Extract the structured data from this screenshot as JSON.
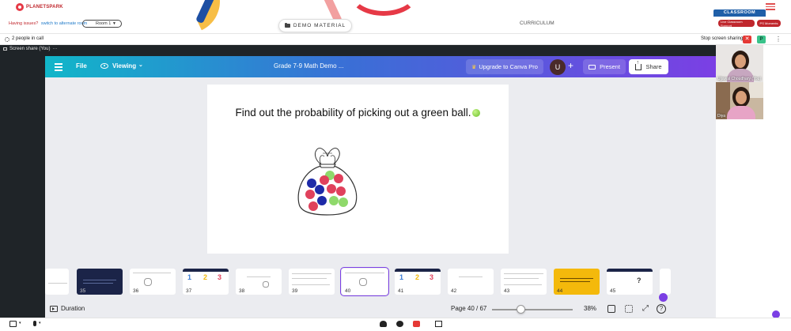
{
  "header": {
    "logo_text": "PLANETSPARK",
    "issues_text": "Having issues?",
    "alternate_room_link": "switch to alternate room",
    "room_select_value": "Room 1",
    "demo_material_label": "DEMO MATERIAL",
    "curriculum_label": "CURRICULUM",
    "classroom_tab": "CLASSROOM",
    "support_buttons": [
      "Live Classroom Support",
      "PS Moments"
    ]
  },
  "call": {
    "people_count_text": "2 people in call",
    "stop_sharing_label": "Stop screen sharing",
    "p_badge": "P",
    "screen_share_label": "Screen share (You)"
  },
  "canva": {
    "file_label": "File",
    "viewing_label": "Viewing",
    "doc_title": "Grade 7-9 Math Demo ...",
    "upgrade_label": "Upgrade to Canva Pro",
    "avatar_initial": "U",
    "present_label": "Present",
    "share_label": "Share",
    "slide_title": "Find out the probability of picking out a green ball.",
    "duration_label": "Duration",
    "page_label": "Page 40 / 67",
    "zoom_label": "38%",
    "zoom_fraction": 0.38,
    "current_page": 40,
    "thumbnails": [
      "35",
      "36",
      "37",
      "38",
      "39",
      "40",
      "41",
      "42",
      "43",
      "44",
      "45"
    ],
    "selected_thumbnail": "40",
    "help_label": "?"
  },
  "participants": [
    {
      "name": "Ujjawal Choudhary (You)"
    },
    {
      "name": "Diya"
    }
  ],
  "colors": {
    "canva_gradient_start": "#11b6c9",
    "canva_gradient_end": "#7b3fe4",
    "brand_red": "#c0272d",
    "ball_red": "#e0415c",
    "ball_blue": "#1d2aa8",
    "ball_green": "#8fd96b"
  }
}
